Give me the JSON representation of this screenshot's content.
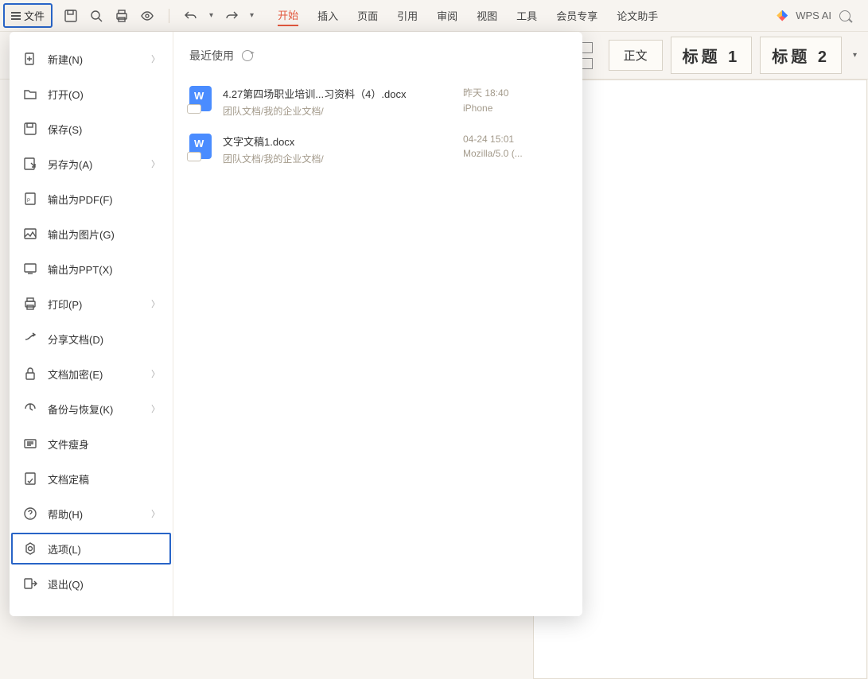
{
  "topbar": {
    "file_label": "文件",
    "tabs": [
      "开始",
      "插入",
      "页面",
      "引用",
      "审阅",
      "视图",
      "工具",
      "会员专享",
      "论文助手"
    ],
    "active_tab_index": 0,
    "ai_label": "WPS AI"
  },
  "styles": {
    "body": "正文",
    "h1": "标题 1",
    "h2": "标题 2"
  },
  "file_menu": {
    "items": [
      {
        "label": "新建(N)",
        "icon": "new-file-icon",
        "chev": true
      },
      {
        "label": "打开(O)",
        "icon": "open-folder-icon",
        "chev": false
      },
      {
        "label": "保存(S)",
        "icon": "save-icon",
        "chev": false
      },
      {
        "label": "另存为(A)",
        "icon": "save-as-icon",
        "chev": true
      },
      {
        "label": "输出为PDF(F)",
        "icon": "export-pdf-icon",
        "chev": false
      },
      {
        "label": "输出为图片(G)",
        "icon": "export-image-icon",
        "chev": false
      },
      {
        "label": "输出为PPT(X)",
        "icon": "export-ppt-icon",
        "chev": false
      },
      {
        "label": "打印(P)",
        "icon": "print-icon",
        "chev": true
      },
      {
        "label": "分享文档(D)",
        "icon": "share-icon",
        "chev": false
      },
      {
        "label": "文档加密(E)",
        "icon": "encrypt-icon",
        "chev": true
      },
      {
        "label": "备份与恢复(K)",
        "icon": "backup-icon",
        "chev": true
      },
      {
        "label": "文件瘦身",
        "icon": "slim-icon",
        "chev": false
      },
      {
        "label": "文档定稿",
        "icon": "finalize-icon",
        "chev": false
      },
      {
        "label": "帮助(H)",
        "icon": "help-icon",
        "chev": true
      },
      {
        "label": "选项(L)",
        "icon": "options-icon",
        "chev": false,
        "highlight": true
      },
      {
        "label": "退出(Q)",
        "icon": "exit-icon",
        "chev": false
      }
    ]
  },
  "recent": {
    "header": "最近使用",
    "items": [
      {
        "title": "4.27第四场职业培训...习资料（4）.docx",
        "path": "团队文档/我的企业文档/",
        "time": "昨天 18:40",
        "device": "iPhone"
      },
      {
        "title": "文字文稿1.docx",
        "path": "团队文档/我的企业文档/",
        "time": "04-24 15:01",
        "device": "Mozilla/5.0 (..."
      }
    ]
  }
}
